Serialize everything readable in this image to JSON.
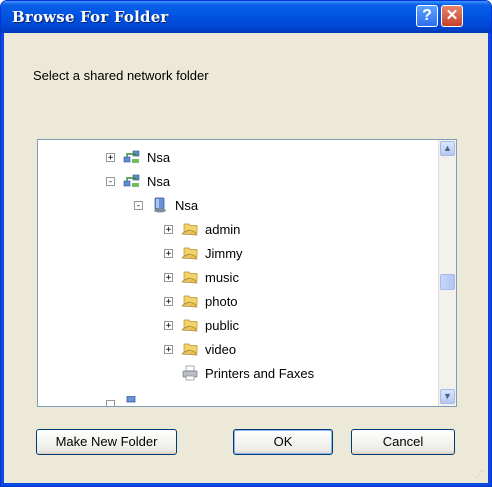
{
  "window": {
    "title": "Browse For Folder"
  },
  "dialog": {
    "instruction": "Select a shared network folder",
    "buttons": {
      "make_new_folder": "Make New Folder",
      "ok": "OK",
      "cancel": "Cancel"
    }
  },
  "tree": {
    "items": [
      {
        "label": "Nsa",
        "expander": "+",
        "icon": "network-computer-icon"
      },
      {
        "label": "Nsa",
        "expander": "-",
        "icon": "network-computer-icon"
      },
      {
        "label": "Nsa",
        "expander": "-",
        "icon": "computer-icon"
      },
      {
        "label": "admin",
        "expander": "+",
        "icon": "shared-folder-icon"
      },
      {
        "label": "Jimmy",
        "expander": "+",
        "icon": "shared-folder-icon"
      },
      {
        "label": "music",
        "expander": "+",
        "icon": "shared-folder-icon"
      },
      {
        "label": "photo",
        "expander": "+",
        "icon": "shared-folder-icon"
      },
      {
        "label": "public",
        "expander": "+",
        "icon": "shared-folder-icon"
      },
      {
        "label": "video",
        "expander": "+",
        "icon": "shared-folder-icon"
      },
      {
        "label": "Printers and Faxes",
        "expander": "",
        "icon": "printer-icon"
      }
    ]
  },
  "colors": {
    "titlebar": "#0054e3",
    "face": "#ece9d8",
    "border": "#7f9db9",
    "close": "#c4432a"
  }
}
